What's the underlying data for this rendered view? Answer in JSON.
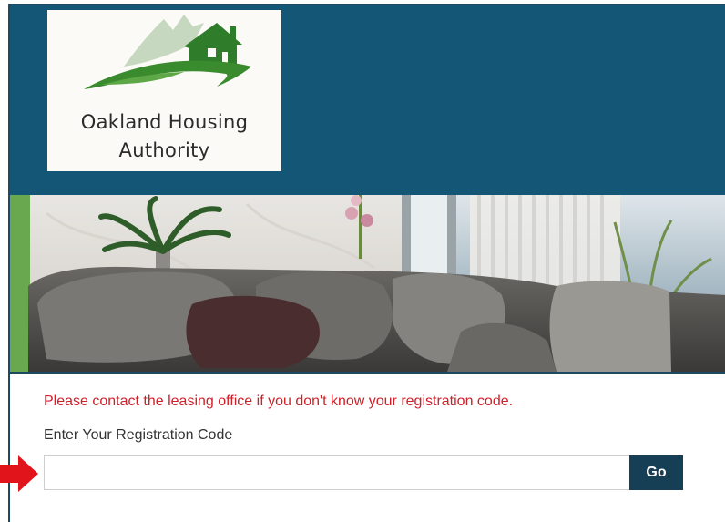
{
  "brand": {
    "logo_line1": "Oakland Housing",
    "logo_line2": "Authority"
  },
  "form": {
    "notice": "Please contact the leasing office if you don't know your registration code.",
    "label": "Enter Your Registration Code",
    "input_value": "",
    "input_placeholder": "",
    "go_label": "Go"
  },
  "colors": {
    "header_bg": "#145675",
    "notice_text": "#d0202a",
    "button_bg": "#163f55",
    "annotation_arrow": "#e0141a",
    "logo_green": "#3a8a2e"
  },
  "icons": {
    "logo": "house-hill-logo-icon",
    "annotation": "arrow-right-icon"
  }
}
